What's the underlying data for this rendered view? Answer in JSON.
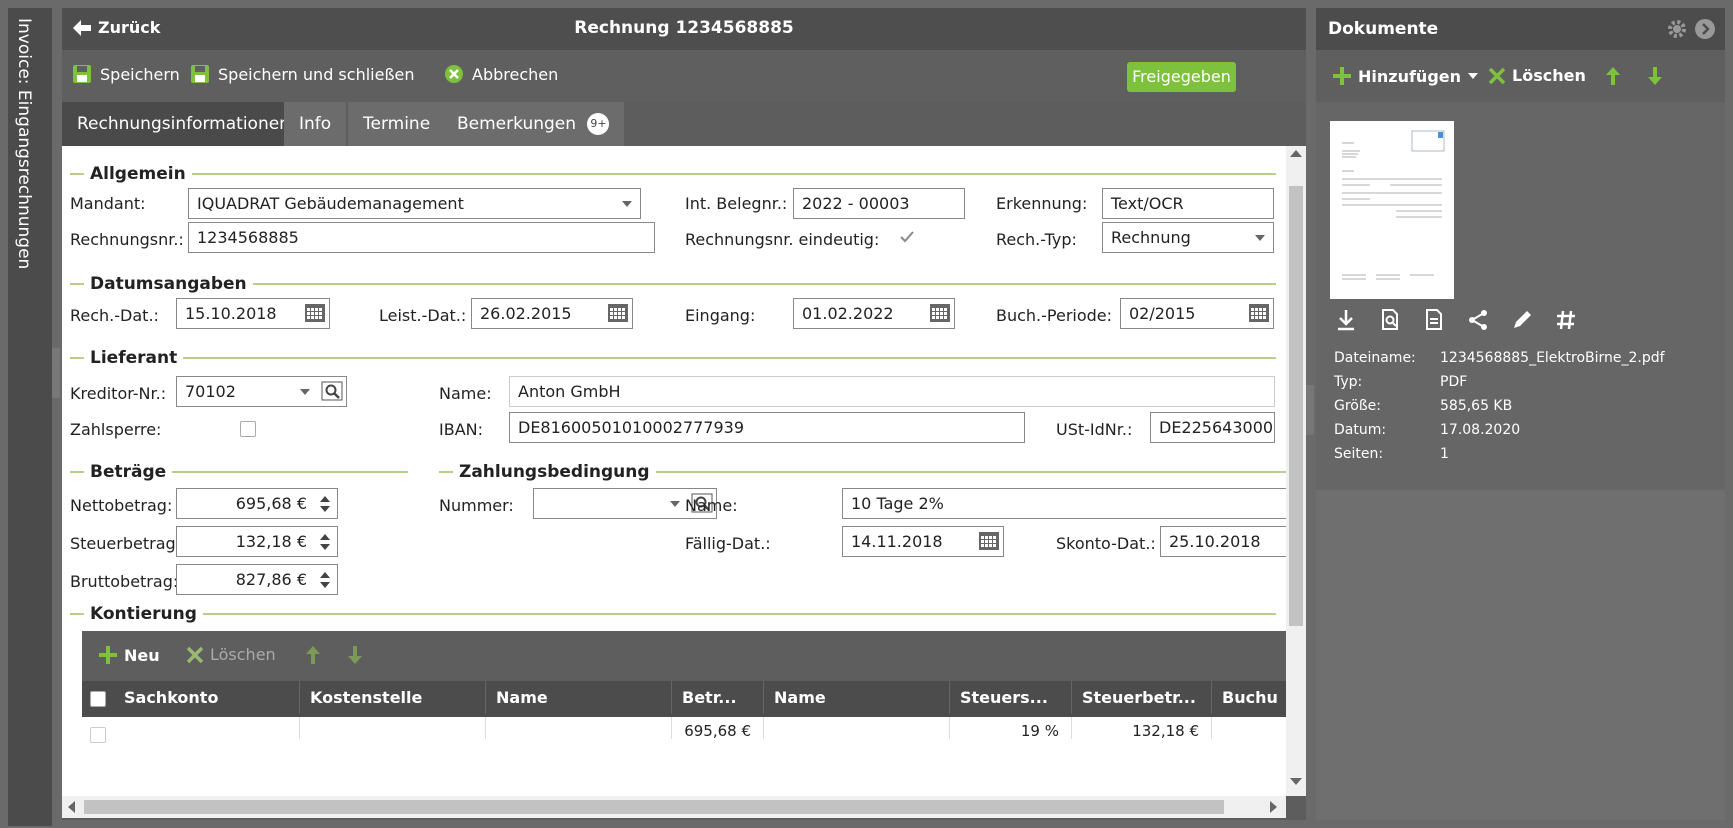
{
  "side_tab": {
    "label": "Invoice: Eingangsrechnungen"
  },
  "header": {
    "back_label": "Zurück",
    "title": "Rechnung 1234568885"
  },
  "toolbar": {
    "save": "Speichern",
    "save_close": "Speichern und schließen",
    "cancel": "Abbrechen",
    "status": "Freigegeben"
  },
  "tabs": [
    {
      "label": "Rechnungsinformationen"
    },
    {
      "label": "Info"
    },
    {
      "label": "Termine"
    },
    {
      "label": "Bemerkungen",
      "badge": "9+"
    }
  ],
  "sections": {
    "general": "Allgemein",
    "dates": "Datumsangaben",
    "supplier": "Lieferant",
    "amounts": "Beträge",
    "payment": "Zahlungsbedingung",
    "accounting": "Kontierung"
  },
  "general": {
    "mandant_label": "Mandant:",
    "mandant_value": "IQUADRAT Gebäudemanagement",
    "belegnr_label": "Int. Belegnr.:",
    "belegnr_value": "2022 - 00003",
    "erkennung_label": "Erkennung:",
    "erkennung_value": "Text/OCR",
    "rechnr_label": "Rechnungsnr.:",
    "rechnr_value": "1234568885",
    "eindeutig_label": "Rechnungsnr. eindeutig:",
    "eindeutig_checked": true,
    "typ_label": "Rech.-Typ:",
    "typ_value": "Rechnung"
  },
  "dates": {
    "rech_label": "Rech.-Dat.:",
    "rech_value": "15.10.2018",
    "leist_label": "Leist.-Dat.:",
    "leist_value": "26.02.2015",
    "eingang_label": "Eingang:",
    "eingang_value": "01.02.2022",
    "periode_label": "Buch.-Periode:",
    "periode_value": "02/2015"
  },
  "supplier": {
    "kreditor_label": "Kreditor-Nr.:",
    "kreditor_value": "70102",
    "name_label": "Name:",
    "name_value": "Anton GmbH",
    "zahlsperre_label": "Zahlsperre:",
    "iban_label": "IBAN:",
    "iban_value": "DE81600501010002777939",
    "ust_label": "USt-IdNr.:",
    "ust_value": "DE225643000"
  },
  "amounts": {
    "netto_label": "Nettobetrag:",
    "netto_value": "695,68 €",
    "steuer_label": "Steuerbetrag:",
    "steuer_value": "132,18 €",
    "brutto_label": "Bruttobetrag:",
    "brutto_value": "827,86 €"
  },
  "payment": {
    "nummer_label": "Nummer:",
    "nummer_value": "",
    "name_label": "Name:",
    "name_value": "10 Tage 2%",
    "faellig_label": "Fällig-Dat.:",
    "faellig_value": "14.11.2018",
    "skonto_label": "Skonto-Dat.:",
    "skonto_value": "25.10.2018"
  },
  "grid": {
    "new_label": "Neu",
    "delete_label": "Löschen",
    "columns": [
      "Sachkonto",
      "Kostenstelle",
      "Name",
      "Betr...",
      "Name",
      "Steuers...",
      "Steuerbetr...",
      "Buchu"
    ],
    "row": {
      "betrag": "695,68 €",
      "steuersatz": "19 %",
      "steuerbetrag": "132,18 €"
    }
  },
  "documents": {
    "title": "Dokumente",
    "add_label": "Hinzufügen",
    "delete_label": "Löschen",
    "meta": [
      {
        "label": "Dateiname:",
        "value": "1234568885_ElektroBirne_2.pdf"
      },
      {
        "label": "Typ:",
        "value": "PDF"
      },
      {
        "label": "Größe:",
        "value": "585,65 KB"
      },
      {
        "label": "Datum:",
        "value": "17.08.2020"
      },
      {
        "label": "Seiten:",
        "value": "1"
      }
    ]
  },
  "colors": {
    "accent": "#7dc13c",
    "section_line": "#b8cf8b",
    "dark": "#4c4c4c"
  }
}
